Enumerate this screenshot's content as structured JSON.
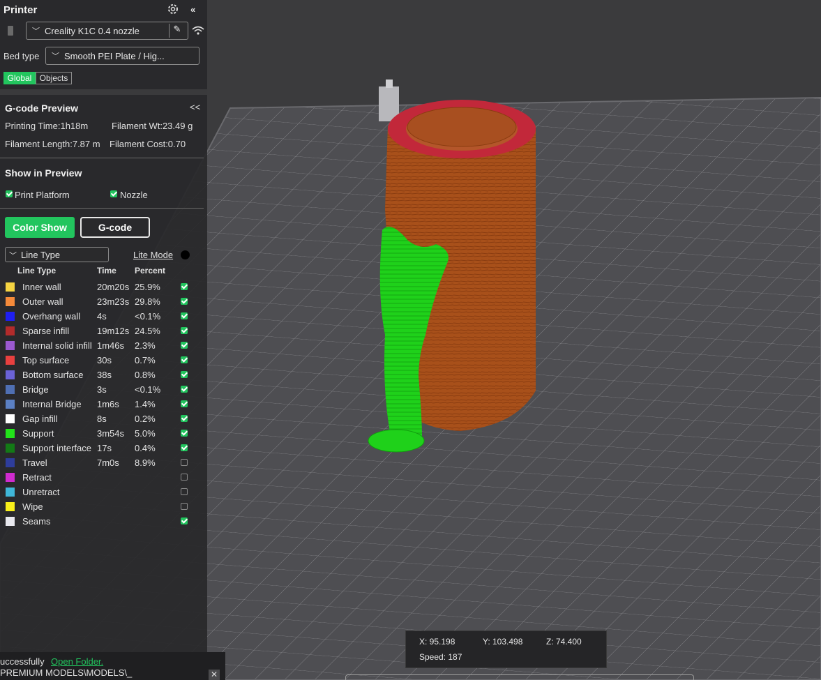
{
  "printer": {
    "title": "Printer",
    "name": "Creality K1C 0.4 nozzle",
    "bed_label": "Bed type",
    "bed_value": "Smooth PEI Plate / Hig...",
    "tabs": [
      "Global",
      "Objects"
    ],
    "settings_icon": "gear-icon",
    "collapse_icon": "double-chevron-left-icon"
  },
  "preview": {
    "title": "G-code Preview",
    "collapse": "<<",
    "printing_time": "Printing Time:1h18m",
    "filament_wt": "Filament Wt:23.49 g",
    "filament_length": "Filament Length:7.87 m",
    "filament_cost": "Filament Cost:0.70"
  },
  "show": {
    "title": "Show in Preview",
    "print_platform": "Print Platform",
    "nozzle": "Nozzle"
  },
  "buttons": {
    "color_show": "Color Show",
    "gcode": "G-code"
  },
  "line_type": {
    "dropdown": "Line Type",
    "lite_mode": "Lite Mode",
    "headers": [
      "Line Type",
      "Time",
      "Percent"
    ],
    "rows": [
      {
        "name": "Inner wall",
        "time": "20m20s",
        "percent": "25.9%",
        "color": "#f5d442",
        "checked": true
      },
      {
        "name": "Outer wall",
        "time": "23m23s",
        "percent": "29.8%",
        "color": "#f58a3a",
        "checked": true
      },
      {
        "name": "Overhang wall",
        "time": "4s",
        "percent": "<0.1%",
        "color": "#1f1ff2",
        "checked": true
      },
      {
        "name": "Sparse infill",
        "time": "19m12s",
        "percent": "24.5%",
        "color": "#b22b2b",
        "checked": true
      },
      {
        "name": "Internal solid infill",
        "time": "1m46s",
        "percent": "2.3%",
        "color": "#9b59d0",
        "checked": true
      },
      {
        "name": "Top surface",
        "time": "30s",
        "percent": "0.7%",
        "color": "#e8403f",
        "checked": true
      },
      {
        "name": "Bottom surface",
        "time": "38s",
        "percent": "0.8%",
        "color": "#6b62d6",
        "checked": true
      },
      {
        "name": "Bridge",
        "time": "3s",
        "percent": "<0.1%",
        "color": "#4f6fb3",
        "checked": true
      },
      {
        "name": "Internal Bridge",
        "time": "1m6s",
        "percent": "1.4%",
        "color": "#5b80c4",
        "checked": true
      },
      {
        "name": "Gap infill",
        "time": "8s",
        "percent": "0.2%",
        "color": "#ffffff",
        "checked": true
      },
      {
        "name": "Support",
        "time": "3m54s",
        "percent": "5.0%",
        "color": "#22e31a",
        "checked": true
      },
      {
        "name": "Support interface",
        "time": "17s",
        "percent": "0.4%",
        "color": "#137a16",
        "checked": true
      },
      {
        "name": "Travel",
        "time": "7m0s",
        "percent": "8.9%",
        "color": "#2e3d9b",
        "checked": false
      },
      {
        "name": "Retract",
        "time": "",
        "percent": "",
        "color": "#d02bd0",
        "checked": false
      },
      {
        "name": "Unretract",
        "time": "",
        "percent": "",
        "color": "#3fb6d8",
        "checked": false
      },
      {
        "name": "Wipe",
        "time": "",
        "percent": "",
        "color": "#f8ef1a",
        "checked": false
      },
      {
        "name": "Seams",
        "time": "",
        "percent": "",
        "color": "#e8e8ee",
        "checked": true
      }
    ]
  },
  "status": {
    "message": "uccessfully",
    "link": "Open Folder.",
    "path": "PREMIUM MODELS\\MODELS\\_"
  },
  "coords": {
    "x": "X: 95.198",
    "y": "Y: 103.498",
    "z": "Z: 74.400",
    "speed": "Speed: 187"
  }
}
